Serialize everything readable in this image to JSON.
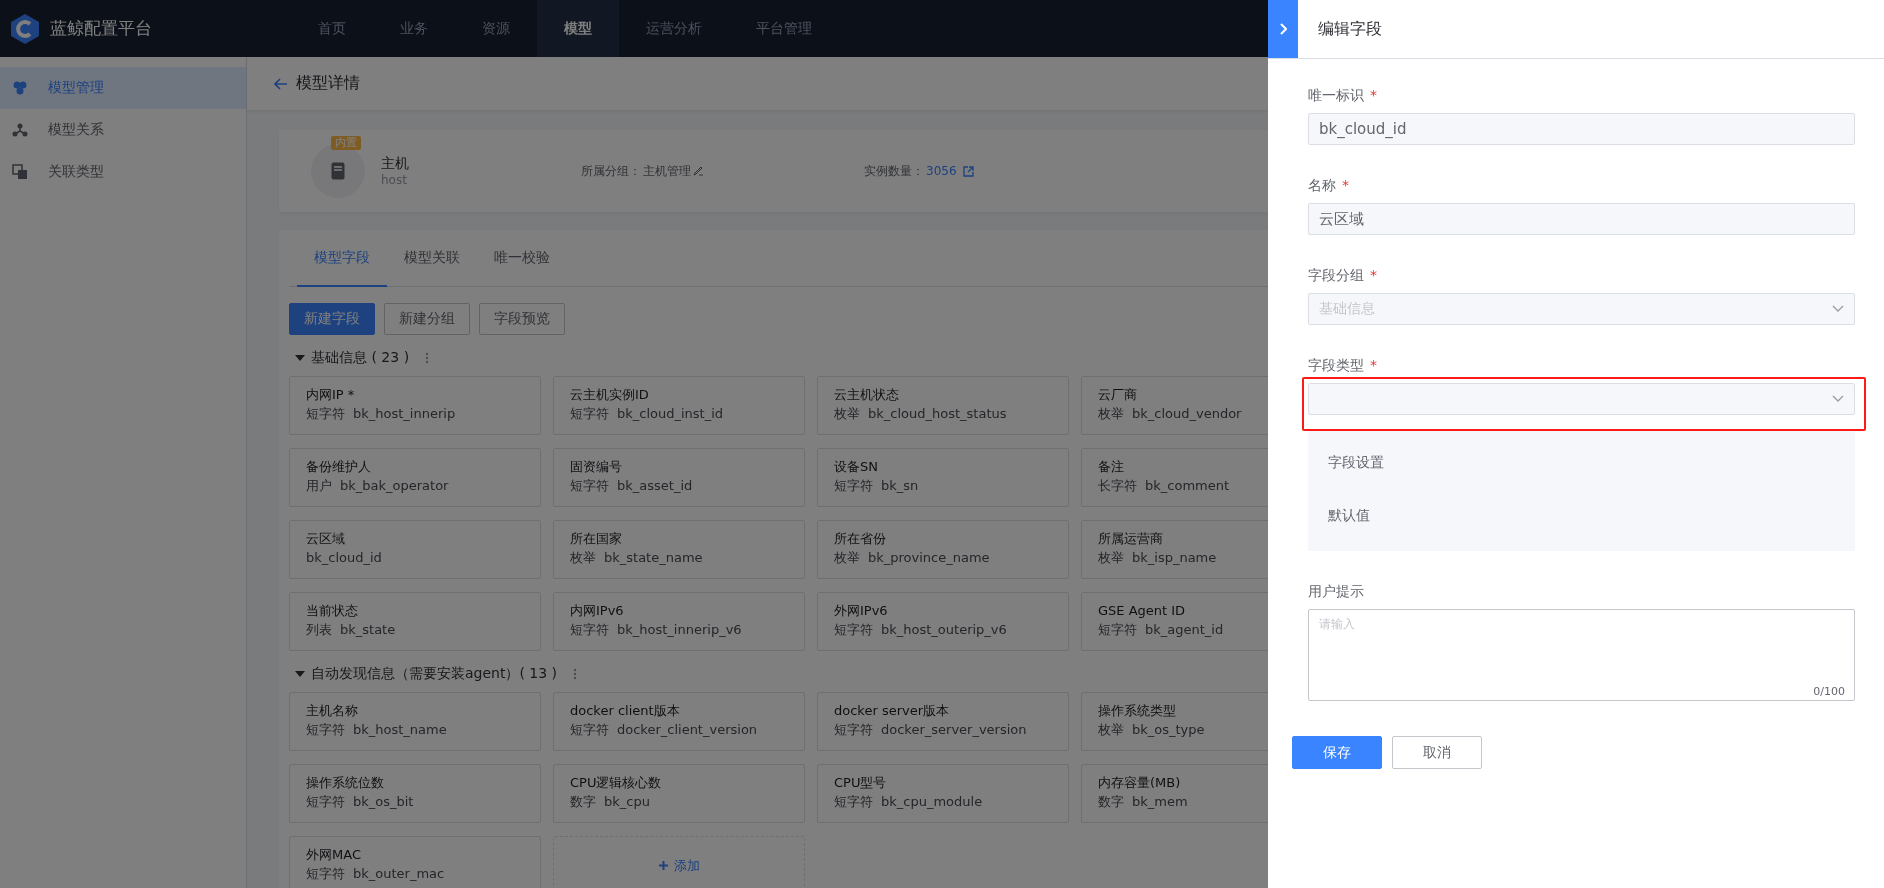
{
  "app": {
    "title": "蓝鲸配置平台"
  },
  "nav": [
    {
      "label": "首页",
      "selected": false
    },
    {
      "label": "业务",
      "selected": false
    },
    {
      "label": "资源",
      "selected": false
    },
    {
      "label": "模型",
      "selected": true
    },
    {
      "label": "运营分析",
      "selected": false
    },
    {
      "label": "平台管理",
      "selected": false
    }
  ],
  "sidebar": [
    {
      "label": "模型管理",
      "selected": true
    },
    {
      "label": "模型关系",
      "selected": false
    },
    {
      "label": "关联类型",
      "selected": false
    }
  ],
  "page_header": {
    "title": "模型详情"
  },
  "model": {
    "badge": "内置",
    "name": "主机",
    "id": "host",
    "group_label": "所属分组：",
    "group": "主机管理",
    "count_label": "实例数量：",
    "count": "3056"
  },
  "tabs": [
    {
      "label": "模型字段",
      "selected": true
    },
    {
      "label": "模型关联",
      "selected": false
    },
    {
      "label": "唯一校验",
      "selected": false
    }
  ],
  "actions": [
    {
      "label": "新建字段",
      "kind": "primary"
    },
    {
      "label": "新建分组",
      "kind": "default"
    },
    {
      "label": "字段预览",
      "kind": "default"
    }
  ],
  "groups": [
    {
      "title": "基础信息 ( 23 )",
      "expanded": true,
      "fields": [
        {
          "name": "内网IP *",
          "type": "短字符",
          "key": "bk_host_innerip"
        },
        {
          "name": "云主机实例ID",
          "type": "短字符",
          "key": "bk_cloud_inst_id"
        },
        {
          "name": "云主机状态",
          "type": "枚举",
          "key": "bk_cloud_host_status"
        },
        {
          "name": "云厂商",
          "type": "枚举",
          "key": "bk_cloud_vendor"
        },
        {
          "name": "备份维护人",
          "type": "用户",
          "key": "bk_bak_operator"
        },
        {
          "name": "固资编号",
          "type": "短字符",
          "key": "bk_asset_id"
        },
        {
          "name": "设备SN",
          "type": "短字符",
          "key": "bk_sn"
        },
        {
          "name": "备注",
          "type": "长字符",
          "key": "bk_comment"
        },
        {
          "name": "云区域",
          "key": "bk_cloud_id"
        },
        {
          "name": "所在国家",
          "type": "枚举",
          "key": "bk_state_name"
        },
        {
          "name": "所在省份",
          "type": "枚举",
          "key": "bk_province_name"
        },
        {
          "name": "所属运营商",
          "type": "枚举",
          "key": "bk_isp_name"
        },
        {
          "name": "当前状态",
          "type": "列表",
          "key": "bk_state"
        },
        {
          "name": "内网IPv6",
          "type": "短字符",
          "key": "bk_host_innerip_v6"
        },
        {
          "name": "外网IPv6",
          "type": "短字符",
          "key": "bk_host_outerip_v6"
        },
        {
          "name": "GSE Agent ID",
          "type": "短字符",
          "key": "bk_agent_id"
        }
      ]
    },
    {
      "title": "自动发现信息（需要安装agent）( 13 )",
      "expanded": true,
      "add_label": "添加",
      "fields": [
        {
          "name": "主机名称",
          "type": "短字符",
          "key": "bk_host_name"
        },
        {
          "name": "docker client版本",
          "type": "短字符",
          "key": "docker_client_version"
        },
        {
          "name": "docker server版本",
          "type": "短字符",
          "key": "docker_server_version"
        },
        {
          "name": "操作系统类型",
          "type": "枚举",
          "key": "bk_os_type"
        },
        {
          "name": "操作系统位数",
          "type": "短字符",
          "key": "bk_os_bit"
        },
        {
          "name": "CPU逻辑核心数",
          "type": "数字",
          "key": "bk_cpu"
        },
        {
          "name": "CPU型号",
          "type": "短字符",
          "key": "bk_cpu_module"
        },
        {
          "name": "内存容量(MB)",
          "type": "数字",
          "key": "bk_mem"
        },
        {
          "name": "外网MAC",
          "type": "短字符",
          "key": "bk_outer_mac"
        }
      ]
    }
  ],
  "panel": {
    "title": "编辑字段",
    "fields": [
      {
        "label": "唯一标识",
        "mark": "*",
        "kind": "input",
        "value": "bk_cloud_id",
        "disabled": false,
        "highlighted": false
      },
      {
        "label": "名称",
        "mark": "*",
        "kind": "input",
        "value": "云区域",
        "disabled": false,
        "highlighted": false
      },
      {
        "label": "字段分组",
        "mark": "*",
        "kind": "select",
        "value": "基础信息",
        "disabled": true,
        "highlighted": false
      },
      {
        "label": "字段类型",
        "mark": "*",
        "kind": "select",
        "disabled": false,
        "highlighted": true
      }
    ],
    "settings": [
      "字段设置",
      "默认值"
    ],
    "hint": {
      "label": "用户提示",
      "placeholder": "请输入",
      "counter": "0/100"
    },
    "buttons": [
      {
        "label": "保存",
        "kind": "primary"
      },
      {
        "label": "取消",
        "kind": "default"
      }
    ]
  }
}
